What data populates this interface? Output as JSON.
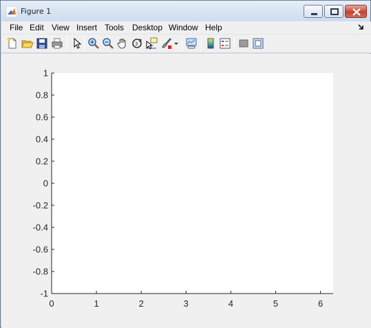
{
  "window": {
    "title": "Figure 1",
    "controls": [
      "minimize",
      "maximize",
      "close"
    ]
  },
  "menubar": {
    "items": [
      "File",
      "Edit",
      "View",
      "Insert",
      "Tools",
      "Desktop",
      "Window",
      "Help"
    ]
  },
  "toolbar": {
    "icons": [
      "new-figure-icon",
      "open-file-icon",
      "save-icon",
      "print-icon",
      "pointer-icon",
      "zoom-in-icon",
      "zoom-out-icon",
      "pan-hand-icon",
      "rotate-3d-icon",
      "data-cursor-icon",
      "brush-icon",
      "brush-dropdown-icon",
      "link-plot-icon",
      "colorbar-icon",
      "legend-icon",
      "hide-plot-tools-icon",
      "show-plot-tools-icon"
    ]
  },
  "chart_data": {
    "type": "line",
    "title": "",
    "xlabel": "",
    "ylabel": "",
    "xlim": [
      0,
      6.2832
    ],
    "ylim": [
      -1,
      1
    ],
    "xticks": [
      0,
      1,
      2,
      3,
      4,
      5,
      6
    ],
    "xtick_labels": [
      "0",
      "1",
      "2",
      "3",
      "4",
      "5",
      "6"
    ],
    "yticks": [
      1,
      0.8,
      0.6,
      0.4,
      0.2,
      0,
      -0.2,
      -0.4,
      -0.6,
      -0.8,
      -1
    ],
    "ytick_labels": [
      "1",
      "0.8",
      "0.6",
      "0.4",
      "0.2",
      "0",
      "-0.2",
      "-0.4",
      "-0.6",
      "-0.8",
      "-1"
    ],
    "series": [],
    "grid": false,
    "axes_background": "#ffffff",
    "figure_background": "#f0f0f0"
  }
}
